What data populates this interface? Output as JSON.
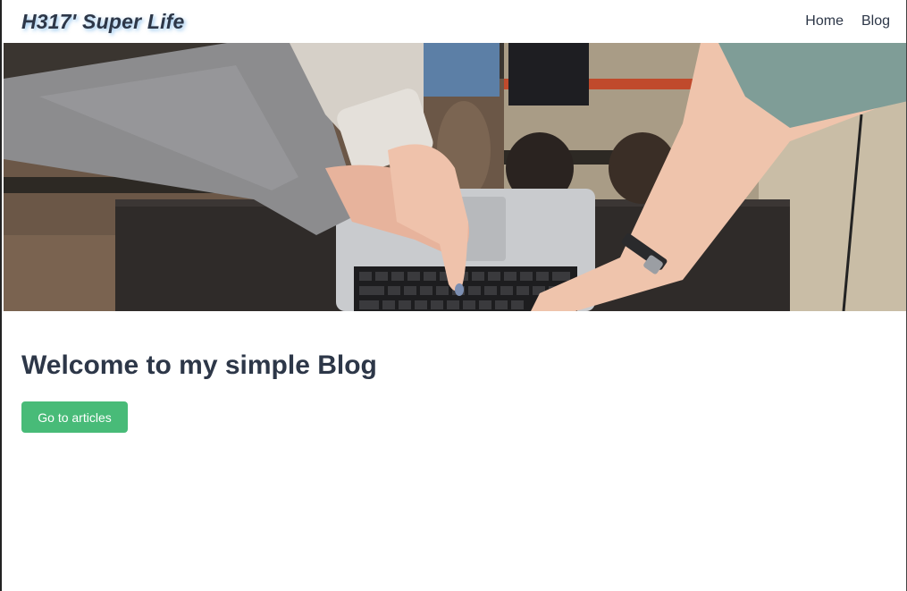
{
  "header": {
    "brand": "H317' Super Life",
    "nav": [
      {
        "label": "Home"
      },
      {
        "label": "Blog"
      }
    ]
  },
  "hero": {
    "alt": "People pointing at a laptop keyboard"
  },
  "main": {
    "heading": "Welcome to my simple Blog",
    "cta_label": "Go to articles"
  },
  "colors": {
    "accent_button": "#48bb78",
    "text": "#2d3748",
    "brand_shadow": "#4299e1"
  }
}
